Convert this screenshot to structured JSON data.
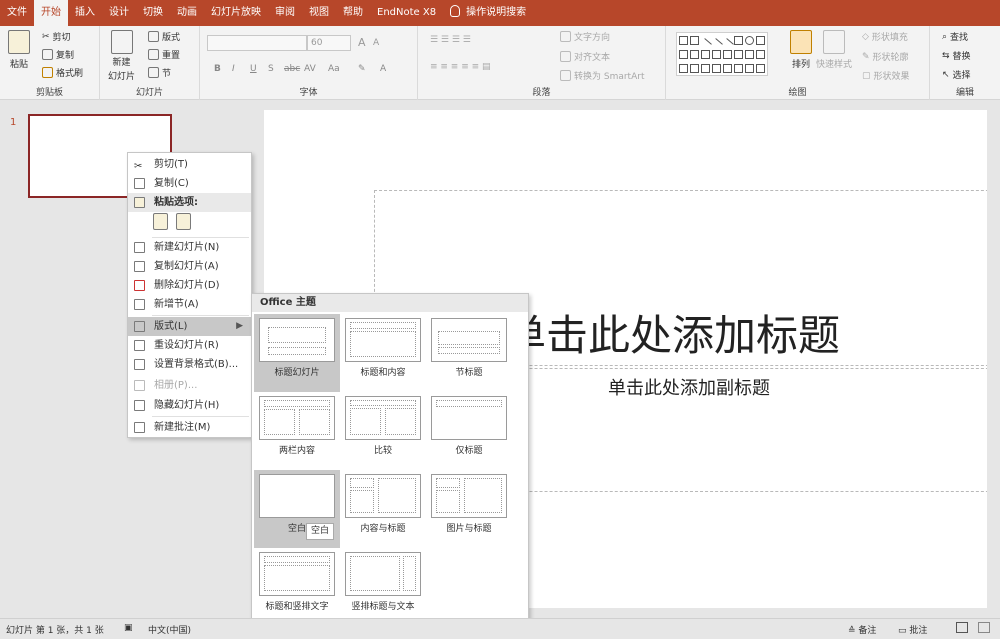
{
  "tabs": [
    "文件",
    "开始",
    "插入",
    "设计",
    "切换",
    "动画",
    "幻灯片放映",
    "审阅",
    "视图",
    "帮助",
    "EndNote X8",
    "操作说明搜索"
  ],
  "active_tab": "开始",
  "ribbon": {
    "clipboard": {
      "paste": "粘贴",
      "cut": "剪切",
      "copy": "复制",
      "format_painter": "格式刷",
      "label": "剪贴板"
    },
    "slides": {
      "new_slide_line1": "新建",
      "new_slide_line2": "幻灯片",
      "layout": "版式",
      "reset": "重置",
      "section": "节",
      "label": "幻灯片"
    },
    "font": {
      "size": "60",
      "label": "字体",
      "bold": "B",
      "italic": "I",
      "underline": "U",
      "shadow": "S",
      "strike": "abc",
      "spacing": "AV",
      "case": "Aa",
      "grow": "A",
      "shrink": "A",
      "color": "A"
    },
    "paragraph": {
      "text_direction": "文字方向",
      "align_text": "对齐文本",
      "smartart": "转换为 SmartArt",
      "label": "段落"
    },
    "drawing": {
      "arrange": "排列",
      "quick_styles": "快速样式",
      "shape_fill": "形状填充",
      "shape_outline": "形状轮廓",
      "shape_effects": "形状效果",
      "label": "绘图"
    },
    "editing": {
      "find": "查找",
      "replace": "替换",
      "select": "选择",
      "label": "编辑"
    }
  },
  "thumbnail": {
    "number": "1"
  },
  "slide": {
    "title": "单击此处添加标题",
    "subtitle": "单击此处添加副标题"
  },
  "context_menu": {
    "cut": "剪切(T)",
    "copy": "复制(C)",
    "paste_options": "粘贴选项:",
    "new_slide": "新建幻灯片(N)",
    "duplicate_slide": "复制幻灯片(A)",
    "delete_slide": "删除幻灯片(D)",
    "add_section": "新增节(A)",
    "layout": "版式(L)",
    "reset_slide": "重设幻灯片(R)",
    "format_background": "设置背景格式(B)...",
    "photo_album": "相册(P)...",
    "hide_slide": "隐藏幻灯片(H)",
    "new_comment": "新建批注(M)"
  },
  "layout_gallery": {
    "header": "Office 主题",
    "layouts": [
      "标题幻灯片",
      "标题和内容",
      "节标题",
      "两栏内容",
      "比较",
      "仅标题",
      "空白",
      "内容与标题",
      "图片与标题",
      "标题和竖排文字",
      "竖排标题与文本"
    ],
    "selected": "空白",
    "tooltip": "空白"
  },
  "status_bar": {
    "slide_info": "幻灯片 第 1 张，共 1 张",
    "language": "中文(中国)",
    "notes": "备注",
    "comments": "批注"
  }
}
